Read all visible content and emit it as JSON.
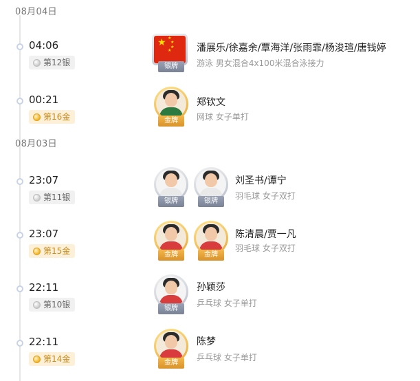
{
  "groups": [
    {
      "date": "08月04日",
      "entries": [
        {
          "time": "04:06",
          "rank": "第12银",
          "medal": "silver",
          "medal_label": "银牌",
          "athletes": "潘展乐/徐嘉余/覃海洋/张雨霏/杨浚瑄/唐钱婷",
          "event": "游泳 男女混合4x100米混合泳接力",
          "avatar": "flag"
        },
        {
          "time": "00:21",
          "rank": "第16金",
          "medal": "gold",
          "medal_label": "金牌",
          "athletes": "郑钦文",
          "event": "网球 女子单打",
          "avatar": "single"
        }
      ]
    },
    {
      "date": "08月03日",
      "entries": [
        {
          "time": "23:07",
          "rank": "第11银",
          "medal": "silver",
          "medal_label": "银牌",
          "athletes": "刘圣书/谭宁",
          "event": "羽毛球 女子双打",
          "avatar": "double"
        },
        {
          "time": "23:07",
          "rank": "第15金",
          "medal": "gold",
          "medal_label": "金牌",
          "athletes": "陈清晨/贾一凡",
          "event": "羽毛球 女子双打",
          "avatar": "double"
        },
        {
          "time": "22:11",
          "rank": "第10银",
          "medal": "silver",
          "medal_label": "银牌",
          "athletes": "孙颖莎",
          "event": "乒乓球 女子单打",
          "avatar": "single"
        },
        {
          "time": "22:11",
          "rank": "第14金",
          "medal": "gold",
          "medal_label": "金牌",
          "athletes": "陈梦",
          "event": "乒乓球 女子单打",
          "avatar": "single"
        }
      ]
    }
  ],
  "colors": {
    "gold": "#e9a83a",
    "silver": "#9aa3b5",
    "timeline": "#e6e6e6"
  }
}
